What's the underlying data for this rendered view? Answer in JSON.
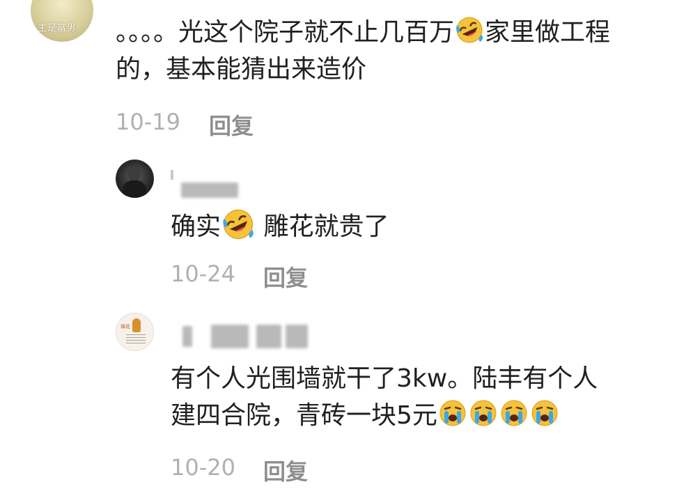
{
  "thread": {
    "top_comment": {
      "avatar_art_text": "主是富男",
      "text_parts": [
        "。。。。光这个院子就不止几百万",
        "家里做工程的，基本能猜出来造价"
      ],
      "date": "10-19",
      "reply_label": "回复"
    },
    "replies": [
      {
        "text_before": "确实",
        "text_after": " 雕花就贵了",
        "date": "10-24",
        "reply_label": "回复"
      },
      {
        "avatar_mark": "禅花",
        "text_lines": [
          "有个人光围墙就干了3kw。陆丰有个人",
          "建四合院，青砖一块5元"
        ],
        "date": "10-20",
        "reply_label": "回复"
      }
    ]
  },
  "icons": [
    "rolling-laughing-emoji",
    "crying-emoji"
  ],
  "colors": {
    "text": "#202020",
    "meta": "#b0b0b0",
    "reply": "#8e8e8e",
    "emoji_face": "#f5c23a",
    "tears": "#39a9e8"
  }
}
